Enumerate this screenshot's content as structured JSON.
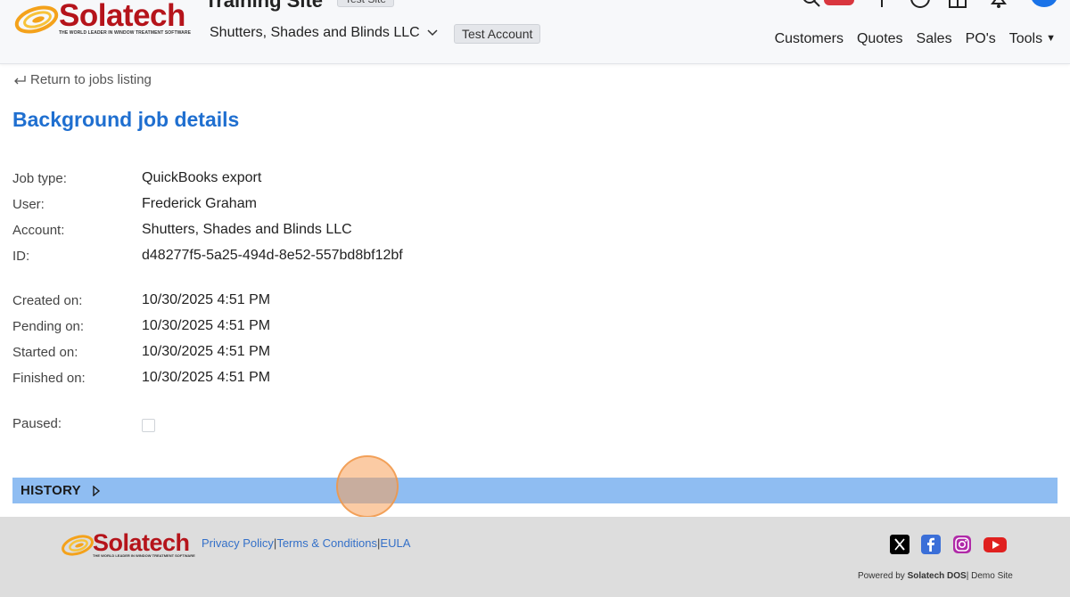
{
  "header": {
    "logo_text": "Solatech",
    "logo_tagline": "THE WORLD LEADER IN WINDOW TREATMENT SOFTWARE",
    "site_title": "Training Site",
    "site_badge": "Test Site",
    "account_name": "Shutters, Shades and Blinds LLC",
    "account_badge": "Test Account",
    "nav": {
      "customers": "Customers",
      "quotes": "Quotes",
      "sales": "Sales",
      "pos": "PO's",
      "tools": "Tools"
    },
    "icons": [
      "search-icon",
      "notification-badge",
      "plus-icon",
      "help-icon",
      "gift-icon",
      "bell-icon",
      "avatar"
    ]
  },
  "main": {
    "back_link": "Return to jobs listing",
    "title": "Background job details",
    "fields": {
      "job_type": {
        "label": "Job type:",
        "value": "QuickBooks export"
      },
      "user": {
        "label": "User:",
        "value": "Frederick Graham"
      },
      "account": {
        "label": "Account:",
        "value": "Shutters, Shades and Blinds LLC"
      },
      "id": {
        "label": "ID:",
        "value": "d48277f5-5a25-494d-8e52-557bd8bf12bf"
      },
      "created_on": {
        "label": "Created on:",
        "value": "10/30/2025 4:51 PM"
      },
      "pending_on": {
        "label": "Pending on:",
        "value": "10/30/2025 4:51 PM"
      },
      "started_on": {
        "label": "Started on:",
        "value": "10/30/2025 4:51 PM"
      },
      "finished_on": {
        "label": "Finished on:",
        "value": "10/30/2025 4:51 PM"
      },
      "paused": {
        "label": "Paused:",
        "checked": false
      }
    },
    "history_label": "HISTORY"
  },
  "footer": {
    "logo_text": "Solatech",
    "logo_tagline": "THE WORLD LEADER IN WINDOW TREATMENT SOFTWARE",
    "links": {
      "privacy": "Privacy Policy",
      "terms": "Terms & Conditions",
      "eula": "EULA",
      "separator": "|"
    },
    "socials": [
      "x-icon",
      "facebook-icon",
      "instagram-icon",
      "youtube-icon"
    ],
    "powered_prefix": "Powered by",
    "powered_brand": "Solatech DOS",
    "powered_suffix": "| Demo Site"
  },
  "colors": {
    "brand_red": "#b5141b",
    "accent_blue": "#1f6fd0",
    "history_bar": "#8fbdf2",
    "link_blue": "#3470c8"
  }
}
